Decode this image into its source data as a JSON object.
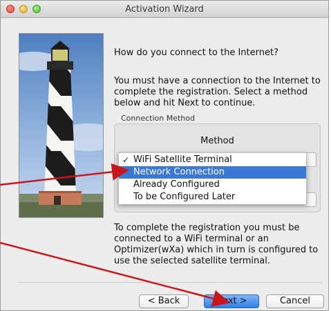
{
  "window": {
    "title": "Activation Wizard"
  },
  "content": {
    "question": "How do you connect to the Internet?",
    "instructions": "You must have a connection to the Internet to complete the registration. Select a method below and hit Next to continue.",
    "group_label": "Connection Method",
    "method_label": "Method",
    "menu": {
      "items": [
        {
          "label": "WiFi Satellite Terminal",
          "checked": true
        },
        {
          "label": "Network Connection",
          "highlighted": true
        },
        {
          "label": "Already Configured"
        },
        {
          "label": "To be Configured Later"
        }
      ],
      "check_mark": "✓"
    },
    "footer_text": "To complete the registration you must be connected to a WiFi terminal or an Optimizer(wXa) which in turn is configured to use the selected satellite terminal."
  },
  "buttons": {
    "back": "< Back",
    "next": "Next >",
    "cancel": "Cancel"
  },
  "colors": {
    "highlight": "#3a78d6",
    "annotation_arrow": "#c8161d"
  }
}
